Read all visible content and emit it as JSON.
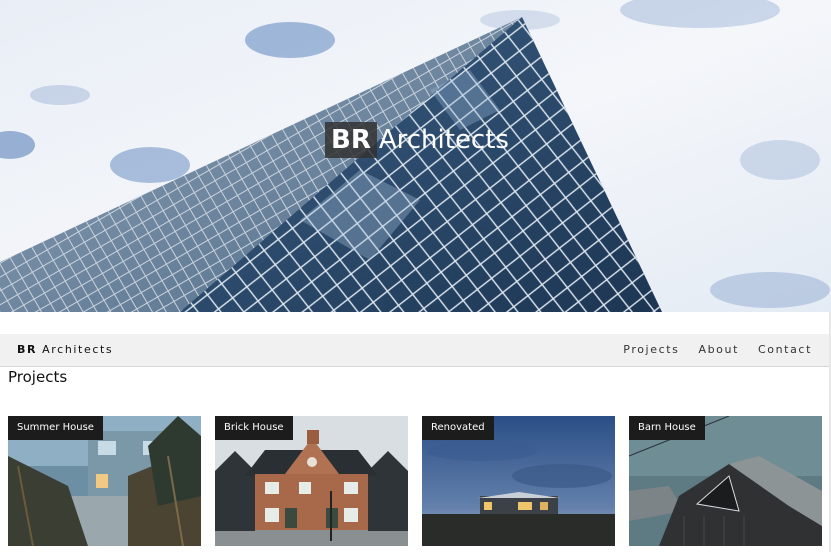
{
  "hero": {
    "logo_bold": "BR",
    "logo_text": "Architects"
  },
  "navbar": {
    "brand_bold": "BR",
    "brand_text": "Architects",
    "links": [
      {
        "label": "Projects"
      },
      {
        "label": "About"
      },
      {
        "label": "Contact"
      }
    ]
  },
  "projects": {
    "heading": "Projects",
    "items": [
      {
        "title": "Summer House"
      },
      {
        "title": "Brick House"
      },
      {
        "title": "Renovated"
      },
      {
        "title": "Barn House"
      }
    ]
  },
  "colors": {
    "navbar_bg": "#f1f1f1",
    "label_bg": "#1c1c1c",
    "hero_sky": "#cfdeef"
  }
}
